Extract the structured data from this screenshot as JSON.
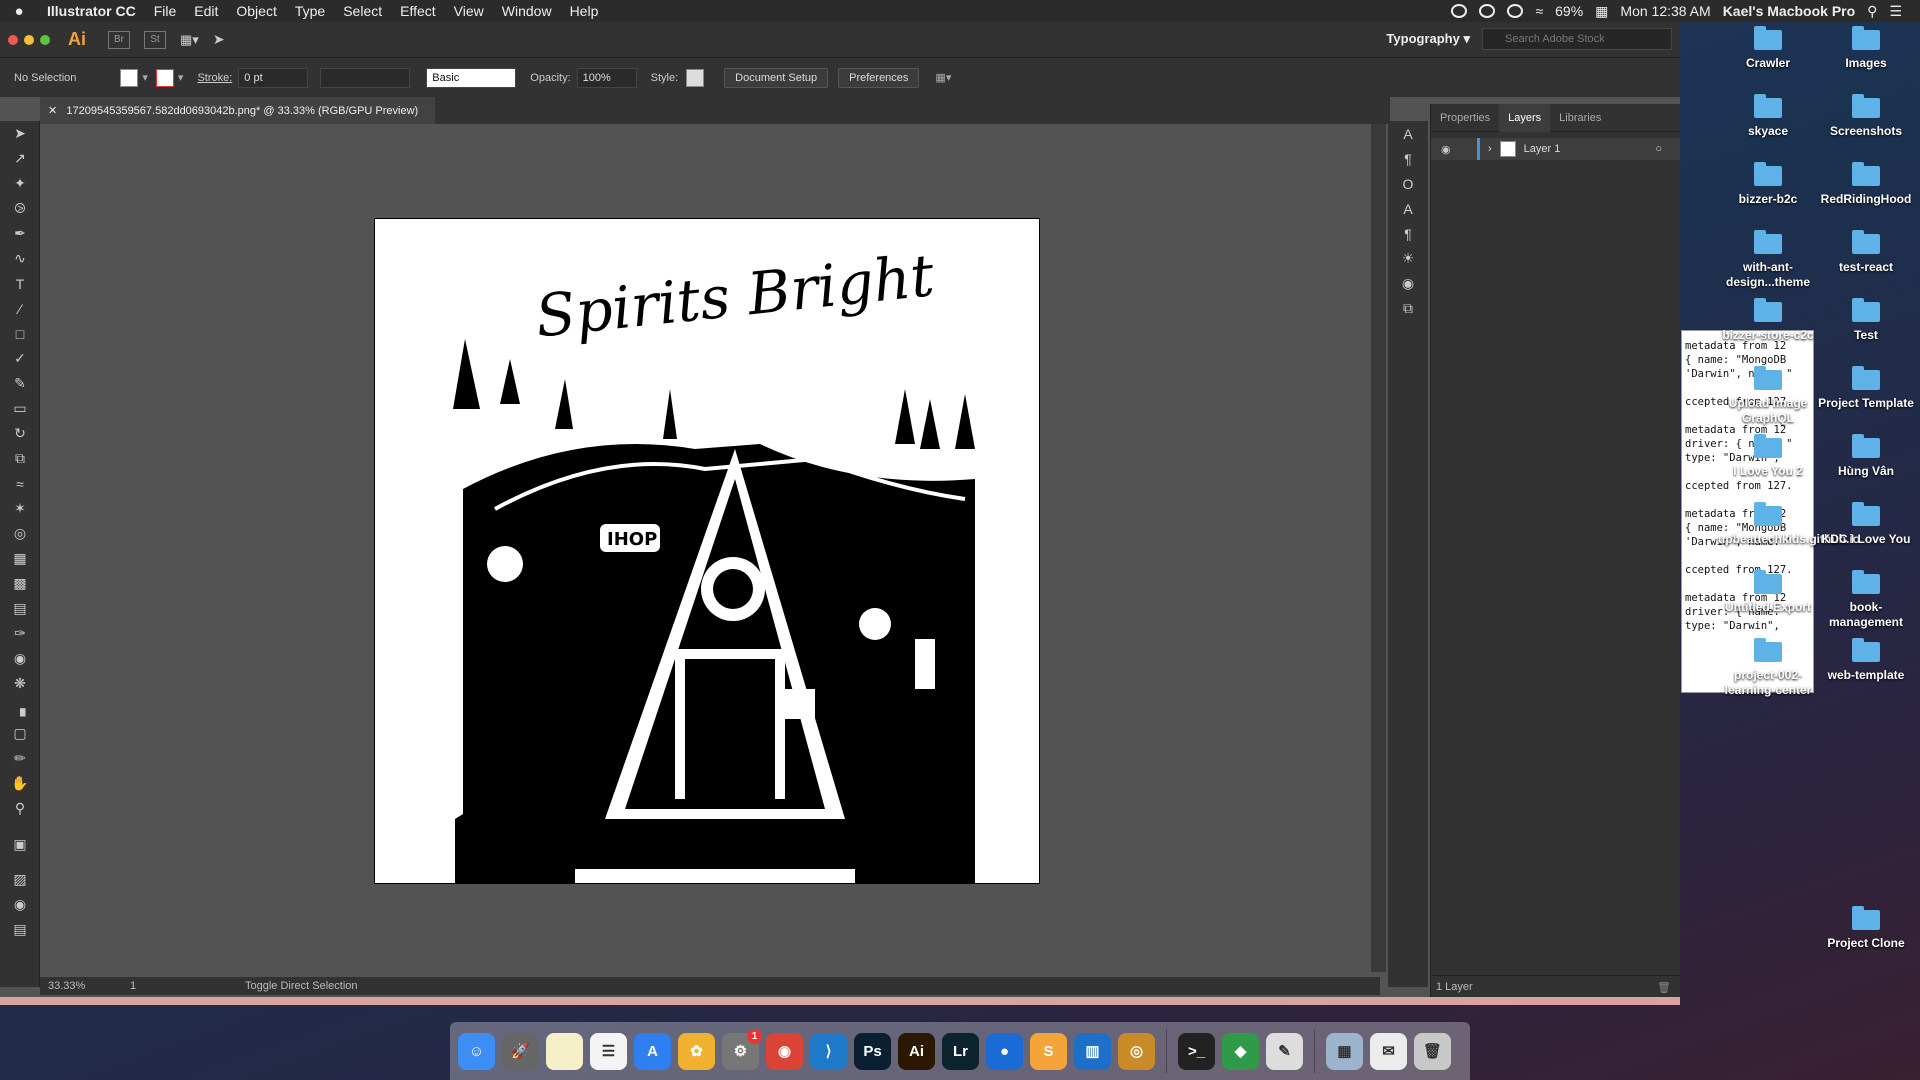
{
  "menubar": {
    "app": "Illustrator CC",
    "items": [
      "File",
      "Edit",
      "Object",
      "Type",
      "Select",
      "Effect",
      "View",
      "Window",
      "Help"
    ],
    "battery": "69%",
    "clock": "Mon 12:38 AM",
    "user": "Kael's Macbook Pro"
  },
  "titlebar": {
    "logo": "Ai",
    "br": "Br",
    "st": "St",
    "workspace": "Typography",
    "search_placeholder": "Search Adobe Stock"
  },
  "control": {
    "selection": "No Selection",
    "stroke_label": "Stroke:",
    "stroke_value": "0 pt",
    "brush": "Basic",
    "opacity_label": "Opacity:",
    "opacity_value": "100%",
    "style_label": "Style:",
    "doc_setup": "Document Setup",
    "preferences": "Preferences"
  },
  "document": {
    "tab_title": "17209545359567.582dd0693042b.png* @ 33.33% (RGB/GPU Preview)",
    "art_title": "Spirits Bright",
    "sign": "IHOP"
  },
  "status": {
    "zoom": "33.33%",
    "page": "1",
    "tool": "Toggle Direct Selection"
  },
  "panel": {
    "tabs": [
      "Properties",
      "Layers",
      "Libraries"
    ],
    "layer": "Layer 1",
    "footer": "1 Layer"
  },
  "terminal": [
    "metadata from 12",
    "{ name: \"MongoDB",
    "'Darwin\", name: \"",
    "",
    "ccepted from 127.",
    "",
    "metadata from 12",
    "driver: { name: \"",
    "type: \"Darwin\",",
    "",
    "ccepted from 127.",
    "",
    "metadata from 12",
    "{ name: \"MongoDB",
    "'Darwin\", name: \"",
    "",
    "ccepted from 127.",
    "",
    "metadata from 12",
    "driver: { name: \"",
    "type: \"Darwin\","
  ],
  "desktop": [
    {
      "label": "Crawler"
    },
    {
      "label": "Images"
    },
    {
      "label": "skyace"
    },
    {
      "label": "Screenshots"
    },
    {
      "label": "bizzer-b2c"
    },
    {
      "label": "RedRidingHood"
    },
    {
      "label": "with-ant-design...theme"
    },
    {
      "label": "test-react"
    },
    {
      "label": "bizzer-store-c2c"
    },
    {
      "label": "Test"
    },
    {
      "label": "Upload Image GraphQL"
    },
    {
      "label": "Project Template"
    },
    {
      "label": "I Love You 2"
    },
    {
      "label": "Hùng Vân"
    },
    {
      "label": "upbeattechkids.github.io"
    },
    {
      "label": "KDC I Love You"
    },
    {
      "label": "Untitled Export"
    },
    {
      "label": "book-management"
    },
    {
      "label": "project-002-learning-center"
    },
    {
      "label": "web-template"
    },
    {
      "label": "Project Clone"
    }
  ],
  "dock": [
    {
      "name": "finder-icon",
      "glyph": "☺",
      "color": "#3d8df5"
    },
    {
      "name": "launchpad-icon",
      "glyph": "🚀",
      "color": "#666"
    },
    {
      "name": "notes-icon",
      "glyph": "",
      "color": "#f5f0c8"
    },
    {
      "name": "reminders-icon",
      "glyph": "☰",
      "color": "#f4f4f4"
    },
    {
      "name": "app-store-icon",
      "glyph": "A",
      "color": "#2f7ff0"
    },
    {
      "name": "photos-icon",
      "glyph": "✿",
      "color": "#f0b030"
    },
    {
      "name": "system-preferences-icon",
      "glyph": "⚙",
      "color": "#777",
      "badge": "1"
    },
    {
      "name": "chrome-icon",
      "glyph": "◉",
      "color": "#d94436"
    },
    {
      "name": "vscode-icon",
      "glyph": "⟩",
      "color": "#1e7ac8"
    },
    {
      "name": "photoshop-icon",
      "glyph": "Ps",
      "color": "#0b1f33"
    },
    {
      "name": "illustrator-icon",
      "glyph": "Ai",
      "color": "#2c1700"
    },
    {
      "name": "lightroom-icon",
      "glyph": "Lr",
      "color": "#0d2330"
    },
    {
      "name": "maps-icon",
      "glyph": "●",
      "color": "#1a6bd6"
    },
    {
      "name": "sketch-icon",
      "glyph": "S",
      "color": "#f3a53a"
    },
    {
      "name": "trello-icon",
      "glyph": "▥",
      "color": "#1e6fc8"
    },
    {
      "name": "overwatch-icon",
      "glyph": "◎",
      "color": "#c98a28"
    },
    {
      "name": "terminal-icon",
      "glyph": ">_",
      "color": "#222"
    },
    {
      "name": "sourcetree-icon",
      "glyph": "◆",
      "color": "#2e9a4a"
    },
    {
      "name": "script-editor-icon",
      "glyph": "✎",
      "color": "#ddd"
    },
    {
      "name": "preview-icon",
      "glyph": "▦",
      "color": "#9cb4cc"
    },
    {
      "name": "mail-icon",
      "glyph": "✉",
      "color": "#ececec"
    },
    {
      "name": "trash-icon",
      "glyph": "🗑",
      "color": "#c8c8c8"
    }
  ]
}
